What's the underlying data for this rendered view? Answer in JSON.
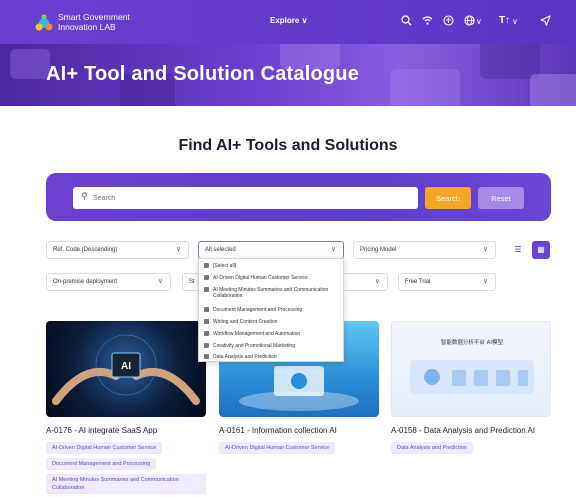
{
  "nav": {
    "logo_line1": "Smart Government",
    "logo_line2": "Innovation LAB",
    "explore": "Explore ∨",
    "icons": [
      "search-icon",
      "wifi-icon",
      "accessibility-icon",
      "globe-icon",
      "text-size-icon",
      "send-icon"
    ]
  },
  "banner": {
    "title": "AI+ Tool and Solution Catalogue"
  },
  "main": {
    "heading": "Find AI+ Tools and Solutions"
  },
  "search": {
    "placeholder": "Search",
    "value": "",
    "search_label": "Search",
    "reset_label": "Reset"
  },
  "filters": {
    "sort": "Ref. Code (Descending)",
    "category": "All selected",
    "pricing": "Pricing Model",
    "deployment": "On-premise deployment",
    "status_partial": "St",
    "trial": "Free Trial"
  },
  "dropdown": {
    "items": [
      "[Select all]",
      "AI-Driven Digital Human Customer Service",
      "AI Meeting Minutes Summaries and Communication Collaboration",
      "Document Management and Processing",
      "Writing and Content Creation",
      "Workflow Management and Automation",
      "Creativity and Promotional Marketing",
      "Data Analysis and Prediction"
    ]
  },
  "cards": [
    {
      "title": "A-0176 - AI integrate SaaS App",
      "image_text": "AI",
      "tags": [
        "AI-Driven Digital Human Customer Service",
        "Document Management and Processing",
        "AI Meeting Minutes Summaries and Communication Collaboration"
      ]
    },
    {
      "title": "A-0161 - Information collection AI",
      "tags": [
        "AI-Driven Digital Human Customer Service"
      ]
    },
    {
      "title": "A-0158 - Data Analysis and Prediction AI",
      "image_text": "智能数据分析平台 AI模型",
      "tags": [
        "Data Analysis and Prediction"
      ]
    }
  ],
  "colors": {
    "primary": "#5a36c4",
    "accent": "#f5a623",
    "reset": "#a68ae8",
    "tag_bg": "#efeaff",
    "tag_text": "#6a48c9"
  }
}
